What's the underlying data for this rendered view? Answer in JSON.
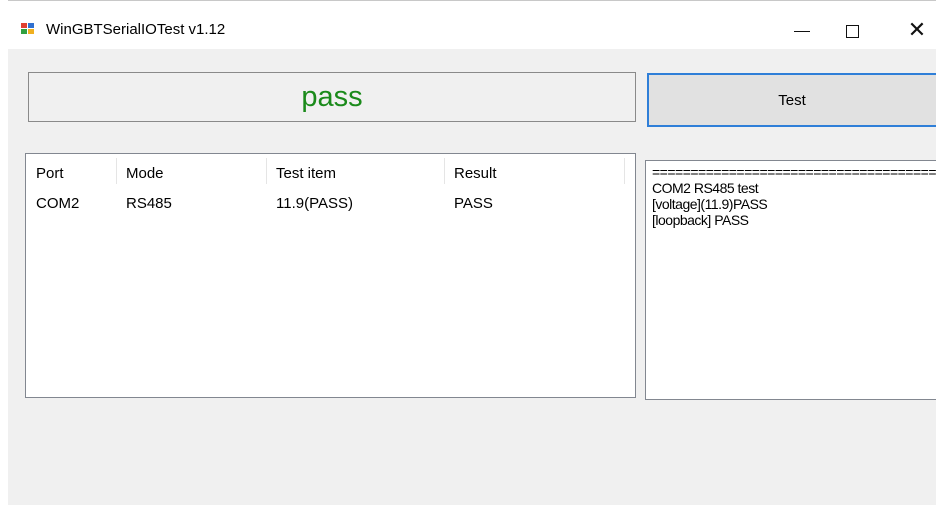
{
  "window": {
    "title": "WinGBTSerialIOTest v1.12",
    "icon": "app-icon",
    "controls": {
      "minimize": "minimize-icon",
      "maximize": "maximize-icon",
      "close": "close-icon"
    }
  },
  "status": {
    "text": "pass",
    "color": "#1a8a1a"
  },
  "test_button": {
    "label": "Test",
    "accent": "#2f7fd8"
  },
  "results_table": {
    "columns": [
      "Port",
      "Mode",
      "Test item",
      "Result"
    ],
    "rows": [
      [
        "COM2",
        "RS485",
        "11.9(PASS)",
        "PASS"
      ]
    ]
  },
  "log": {
    "lines": [
      "============================================",
      "COM2 RS485 test",
      "[voltage](11.9)PASS",
      "[loopback] PASS"
    ]
  }
}
